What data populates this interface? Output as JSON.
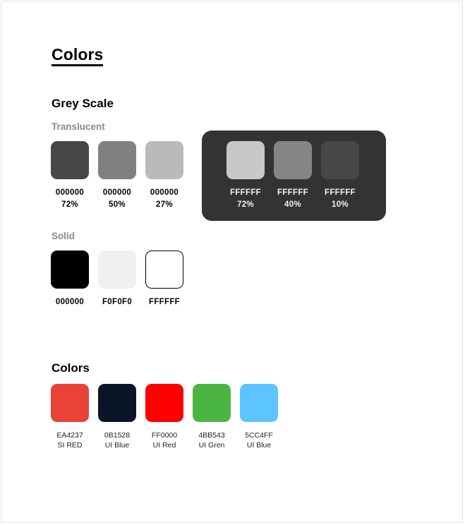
{
  "page": {
    "title": "Colors"
  },
  "grey_scale": {
    "title": "Grey Scale",
    "translucent": {
      "label": "Translucent",
      "on_light": [
        {
          "hex": "000000",
          "opacity": "72%",
          "render_color": "#474747"
        },
        {
          "hex": "000000",
          "opacity": "50%",
          "render_color": "#808080"
        },
        {
          "hex": "000000",
          "opacity": "27%",
          "render_color": "#bababa"
        }
      ],
      "on_dark": {
        "panel_color": "#333333",
        "items": [
          {
            "hex": "FFFFFF",
            "opacity": "72%",
            "render_color": "#c8c8c8"
          },
          {
            "hex": "FFFFFF",
            "opacity": "40%",
            "render_color": "#858585"
          },
          {
            "hex": "FFFFFF",
            "opacity": "10%",
            "render_color": "#474747"
          }
        ]
      }
    },
    "solid": {
      "label": "Solid",
      "items": [
        {
          "hex": "000000",
          "render_color": "#000000"
        },
        {
          "hex": "F0F0F0",
          "render_color": "#f0f0f0"
        },
        {
          "hex": "FFFFFF",
          "render_color": "#ffffff"
        }
      ]
    }
  },
  "colors": {
    "title": "Colors",
    "items": [
      {
        "hex": "EA4237",
        "name": "SI RED",
        "render_color": "#ea4237"
      },
      {
        "hex": "0B1528",
        "name": "UI Blue",
        "render_color": "#0b1528"
      },
      {
        "hex": "FF0000",
        "name": "UI Red",
        "render_color": "#ff0000"
      },
      {
        "hex": "4BB543",
        "name": "UI Gren",
        "render_color": "#4bb543"
      },
      {
        "hex": "5CC4FF",
        "name": "UI Blue",
        "render_color": "#5cc4ff"
      }
    ]
  }
}
